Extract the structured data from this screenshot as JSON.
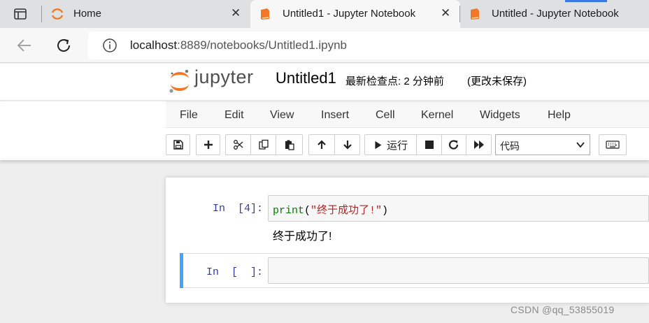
{
  "browser": {
    "tabs": [
      {
        "title": "Home",
        "active": false
      },
      {
        "title": "Untitled1 - Jupyter Notebook",
        "active": true
      },
      {
        "title": "Untitled - Jupyter Notebook",
        "active": false
      }
    ],
    "close_glyph": "✕",
    "url": {
      "host": "localhost",
      "rest": ":8889/notebooks/Untitled1.ipynb"
    }
  },
  "jupyter": {
    "wordmark": "jupyter",
    "notebook_name": "Untitled1",
    "checkpoint": "最新检查点: 2 分钟前",
    "unsaved": "(更改未保存)",
    "menu": [
      "File",
      "Edit",
      "View",
      "Insert",
      "Cell",
      "Kernel",
      "Widgets",
      "Help"
    ],
    "toolbar": {
      "run_label": "运行",
      "cell_type": "代码"
    },
    "colors": {
      "logo_orange": "#f37726",
      "selected_cell": "#42a5f5",
      "prompt": "#303f9f"
    }
  },
  "cells": [
    {
      "prompt": "In  [4]:",
      "code": {
        "fn": "print",
        "open": "(",
        "arg": "\"终于成功了!\"",
        "close": ")"
      },
      "output": "终于成功了!"
    },
    {
      "prompt": "In  [  ]:",
      "code": null,
      "selected": true
    }
  ],
  "watermark": "CSDN @qq_53855019"
}
